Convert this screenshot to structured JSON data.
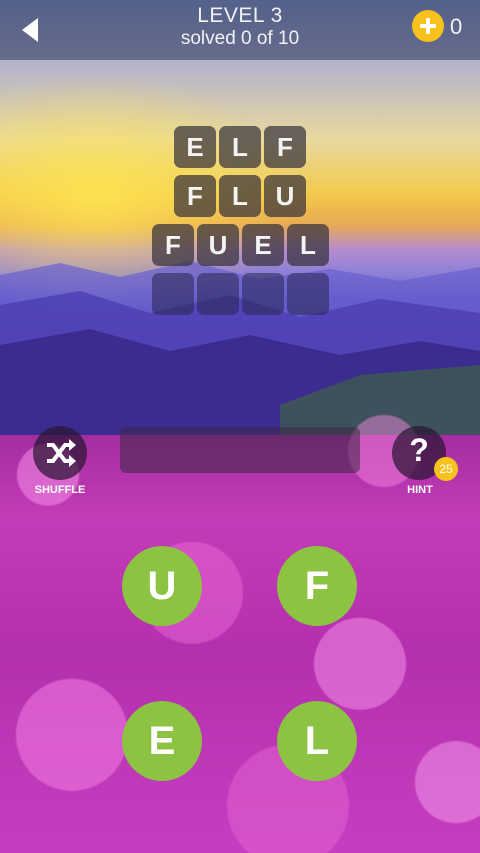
{
  "header": {
    "level_title": "LEVEL 3",
    "progress_text": "solved 0 of 10",
    "coins": "0"
  },
  "grid": {
    "rows": [
      [
        "E",
        "L",
        "F"
      ],
      [
        "F",
        "L",
        "U"
      ],
      [
        "F",
        "U",
        "E",
        "L"
      ],
      [
        "",
        "",
        "",
        ""
      ]
    ]
  },
  "controls": {
    "shuffle_label": "SHUFFLE",
    "hint_label": "HINT",
    "hint_symbol": "?",
    "hint_cost": "25",
    "current_word": ""
  },
  "wheel": {
    "letters": [
      "U",
      "F",
      "E",
      "L"
    ]
  },
  "colors": {
    "letter_bubble": "#8cc342",
    "coin": "#f7c21b"
  },
  "icons": [
    "back-arrow-icon",
    "add-coins-icon",
    "shuffle-icon",
    "hint-icon"
  ]
}
